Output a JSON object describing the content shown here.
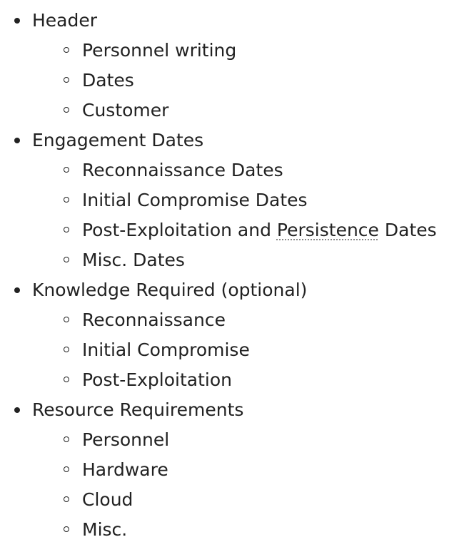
{
  "outline": [
    {
      "label": "Header",
      "children": [
        "Personnel writing",
        "Dates",
        "Customer"
      ]
    },
    {
      "label": "Engagement Dates",
      "children": [
        "Reconnaissance Dates",
        "Initial Compromise Dates",
        "Post-Exploitation and Persistence Dates",
        "Misc. Dates"
      ]
    },
    {
      "label": "Knowledge Required (optional)",
      "children": [
        "Reconnaissance",
        "Initial Compromise",
        "Post-Exploitation"
      ]
    },
    {
      "label": "Resource Requirements",
      "children": [
        "Personnel",
        "Hardware",
        "Cloud",
        "Misc."
      ]
    }
  ],
  "special": {
    "persist_prefix": "Post-Exploitation and ",
    "persist_word": "Persistence",
    "persist_suffix": " Dates"
  }
}
